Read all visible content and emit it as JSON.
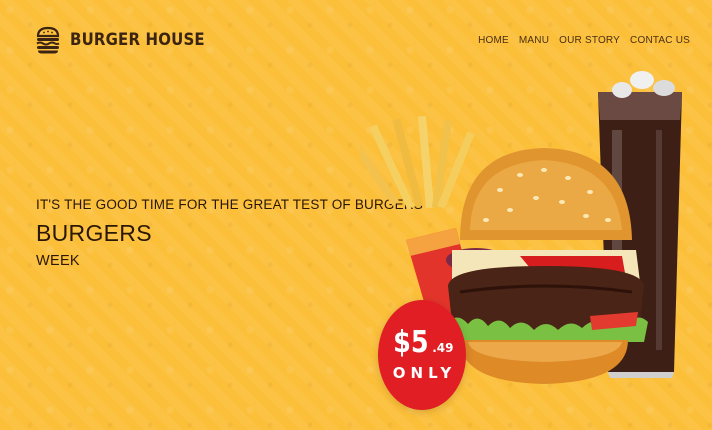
{
  "brand": {
    "name": "BURGER HOUSE",
    "logo_icon": "burger-logo-icon"
  },
  "nav": {
    "items": [
      {
        "label": "HOME"
      },
      {
        "label": "MANU"
      },
      {
        "label": "OUR STORY"
      },
      {
        "label": "CONTAC US"
      }
    ]
  },
  "hero": {
    "tagline": "IT'S THE GOOD TIME FOR THE GREAT TEST OF BURGERS",
    "headline": "BURGERS",
    "subline": "WEEK"
  },
  "offer": {
    "price_main": "$5",
    "price_cents": ".49",
    "note": "ONLY"
  },
  "colors": {
    "background": "#fbbf3a",
    "badge": "#e01e24",
    "text_dark": "#2a1708"
  }
}
